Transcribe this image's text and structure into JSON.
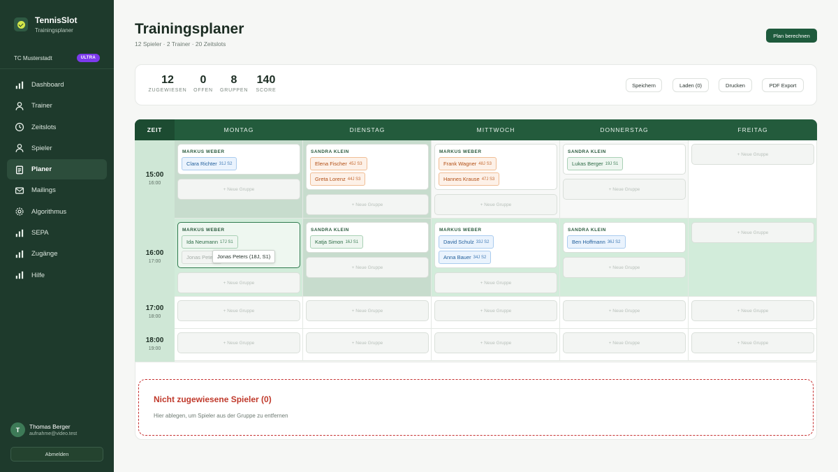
{
  "app": {
    "name": "TennisSlot",
    "subtitle": "Trainingsplaner"
  },
  "club": {
    "name": "TC Musterstadt",
    "badge": "ULTRA"
  },
  "nav": [
    {
      "label": "Dashboard",
      "icon": "bar-chart-icon",
      "active": false
    },
    {
      "label": "Trainer",
      "icon": "person-icon",
      "active": false
    },
    {
      "label": "Zeitslots",
      "icon": "clock-icon",
      "active": false
    },
    {
      "label": "Spieler",
      "icon": "person-icon",
      "active": false
    },
    {
      "label": "Planer",
      "icon": "clipboard-icon",
      "active": true
    },
    {
      "label": "Mailings",
      "icon": "mail-icon",
      "active": false
    },
    {
      "label": "Algorithmus",
      "icon": "gear-icon",
      "active": false
    },
    {
      "label": "SEPA",
      "icon": "bar-chart-icon",
      "active": false
    },
    {
      "label": "Zugänge",
      "icon": "bar-chart-icon",
      "active": false
    },
    {
      "label": "Hilfe",
      "icon": "bar-chart-icon",
      "active": false
    }
  ],
  "user": {
    "initial": "T",
    "name": "Thomas Berger",
    "email": "aufnahme@video.test",
    "logout_label": "Abmelden"
  },
  "header": {
    "title": "Trainingsplaner",
    "subtitle": "12 Spieler · 2 Trainer · 20 Zeitslots",
    "primary_button": "Plan berechnen"
  },
  "stats": [
    {
      "value": "12",
      "label": "ZUGEWIESEN"
    },
    {
      "value": "0",
      "label": "OFFEN"
    },
    {
      "value": "8",
      "label": "GRUPPEN"
    },
    {
      "value": "140",
      "label": "SCORE"
    }
  ],
  "toolbar": {
    "save": "Speichern",
    "load": "Laden (0)",
    "print": "Drucken",
    "pdf": "PDF Export"
  },
  "schedule": {
    "time_header": "ZEIT",
    "days": [
      "MONTAG",
      "DIENSTAG",
      "MITTWOCH",
      "DONNERSTAG",
      "FREITAG"
    ],
    "times": [
      {
        "start": "15:00",
        "end": "16:00"
      },
      {
        "start": "16:00",
        "end": "17:00"
      },
      {
        "start": "17:00",
        "end": "18:00"
      },
      {
        "start": "18:00",
        "end": "19:00"
      }
    ],
    "new_group_label": "+ Neue Gruppe",
    "groups": [
      {
        "day": 0,
        "slot": 0,
        "trainer": "MARKUS WEBER",
        "players": [
          {
            "name": "Clara Richter",
            "meta": "31J S2",
            "color": "blue"
          }
        ]
      },
      {
        "day": 1,
        "slot": 0,
        "trainer": "SANDRA KLEIN",
        "players": [
          {
            "name": "Elena Fischer",
            "meta": "45J S3",
            "color": "orange"
          },
          {
            "name": "Greta Lorenz",
            "meta": "44J S3",
            "color": "orange"
          }
        ]
      },
      {
        "day": 2,
        "slot": 0,
        "trainer": "MARKUS WEBER",
        "players": [
          {
            "name": "Frank Wagner",
            "meta": "48J S3",
            "color": "orange"
          },
          {
            "name": "Hannes Krause",
            "meta": "47J S3",
            "color": "orange"
          }
        ]
      },
      {
        "day": 3,
        "slot": 0,
        "trainer": "SANDRA KLEIN",
        "players": [
          {
            "name": "Lukas Berger",
            "meta": "19J S1",
            "color": "green"
          }
        ]
      },
      {
        "day": 0,
        "slot": 1,
        "trainer": "MARKUS WEBER",
        "highlight": true,
        "players": [
          {
            "name": "Ida Neumann",
            "meta": "17J S1",
            "color": "green"
          },
          {
            "name": "Jonas Peters",
            "meta": "",
            "color": "ghost"
          }
        ]
      },
      {
        "day": 1,
        "slot": 1,
        "trainer": "SANDRA KLEIN",
        "players": [
          {
            "name": "Katja Simon",
            "meta": "16J S1",
            "color": "green"
          }
        ]
      },
      {
        "day": 2,
        "slot": 1,
        "trainer": "MARKUS WEBER",
        "players": [
          {
            "name": "David Schulz",
            "meta": "33J S2",
            "color": "blue"
          },
          {
            "name": "Anna Bauer",
            "meta": "34J S2",
            "color": "blue"
          }
        ]
      },
      {
        "day": 3,
        "slot": 1,
        "trainer": "SANDRA KLEIN",
        "players": [
          {
            "name": "Ben Hoffmann",
            "meta": "36J S2",
            "color": "blue"
          }
        ]
      }
    ],
    "drag_tooltip": "Jonas Peters (18J, S1)"
  },
  "unassigned": {
    "title": "Nicht zugewiesene Spieler (0)",
    "hint": "Hier ablegen, um Spieler aus der Gruppe zu entfernen"
  },
  "colors": {
    "sidebar": "#1e3a2c",
    "accent": "#235b3c",
    "highlight": "#cfe7d6",
    "danger": "#c53030"
  }
}
